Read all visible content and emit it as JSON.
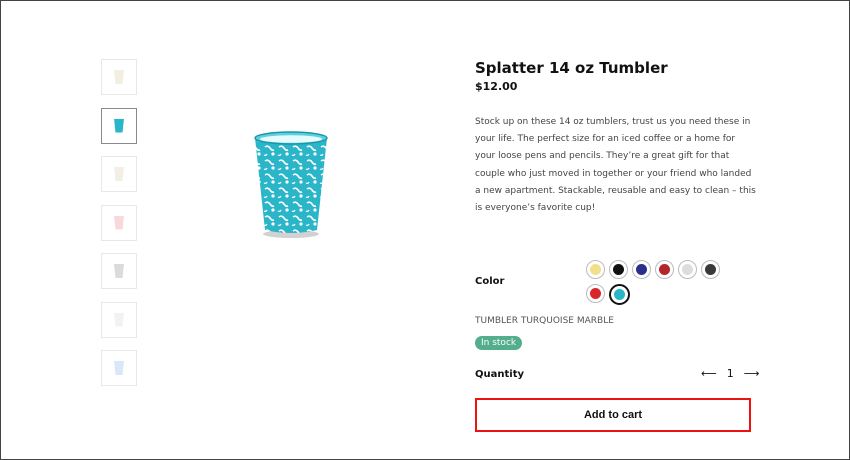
{
  "product": {
    "title": "Splatter 14 oz Tumbler",
    "price": "$12.00",
    "description": "Stock up on these 14 oz tumblers, trust us you need these in your life. The perfect size for an iced coffee or a home for your loose pens and pencils. They’re a great gift for that couple who just moved in together or your friend who landed a new apartment. Stackable, reusable and easy to clean – this is everyone’s favorite cup!"
  },
  "thumbnails": [
    {
      "color": "#e8e0c8",
      "selected": false
    },
    {
      "color": "#2ab6c8",
      "selected": true
    },
    {
      "color": "#e9e2cf",
      "selected": false
    },
    {
      "color": "#f1b9c0",
      "selected": false
    },
    {
      "color": "#bdbdbd",
      "selected": false
    },
    {
      "color": "#e7e7e7",
      "selected": false
    },
    {
      "color": "#b8d6f2",
      "selected": false
    }
  ],
  "color_section": {
    "label": "Color",
    "swatches": [
      {
        "color": "#f2df8a",
        "name": "yellow"
      },
      {
        "color": "#111111",
        "name": "black"
      },
      {
        "color": "#2c2f8a",
        "name": "navy"
      },
      {
        "color": "#b3262a",
        "name": "red"
      },
      {
        "color": "#dddddd",
        "name": "white"
      },
      {
        "color": "#3a3a3a",
        "name": "dark-gray"
      },
      {
        "color": "#d9262d",
        "name": "bright-red"
      },
      {
        "color": "#2ab6c8",
        "name": "turquoise",
        "selected": true
      }
    ],
    "selected_name": "TUMBLER TURQUOISE MARBLE"
  },
  "stock": "In stock",
  "quantity": {
    "label": "Quantity",
    "value": "1",
    "decrement": "⟵",
    "increment": "⟶"
  },
  "cart": {
    "add_label": "Add to cart"
  },
  "colors": {
    "accent": "#54ad8d",
    "highlight": "#e11111",
    "cup": "#2ab6c8"
  }
}
